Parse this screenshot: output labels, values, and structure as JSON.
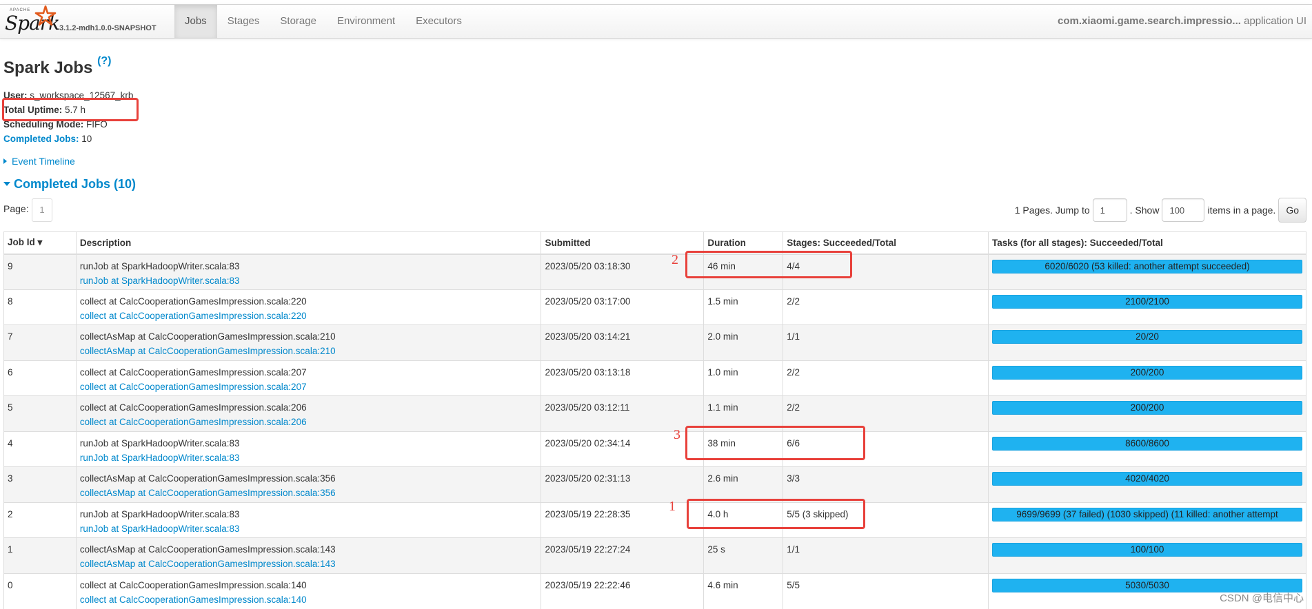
{
  "brand": {
    "apache": "APACHE",
    "name": "Spark",
    "version": "3.1.2-mdh1.0.0-SNAPSHOT"
  },
  "nav": {
    "tabs": [
      "Jobs",
      "Stages",
      "Storage",
      "Environment",
      "Executors"
    ],
    "active": "Jobs",
    "app_name": "com.xiaomi.game.search.impressio...",
    "app_suffix": " application UI"
  },
  "page": {
    "title": "Spark Jobs",
    "help": "(?)"
  },
  "summary": {
    "user_label": "User:",
    "user_value": "s_workspace_12567_krb",
    "uptime_label": "Total Uptime:",
    "uptime_value": "5.7 h",
    "scheduling_label": "Scheduling Mode:",
    "scheduling_value": "FIFO",
    "completed_label": "Completed Jobs:",
    "completed_value": "10"
  },
  "event_timeline": "Event Timeline",
  "section": {
    "title": "Completed Jobs (10)"
  },
  "pagination": {
    "page_label": "Page:",
    "current_page": "1",
    "pages_text": "1 Pages. Jump to",
    "jump_value": "1",
    "show_text": ". Show",
    "show_value": "100",
    "items_text": "items in a page.",
    "go_label": "Go"
  },
  "table": {
    "headers": [
      "Job Id ▾",
      "Description",
      "Submitted",
      "Duration",
      "Stages: Succeeded/Total",
      "Tasks (for all stages): Succeeded/Total"
    ],
    "rows": [
      {
        "id": "9",
        "desc": "runJob at SparkHadoopWriter.scala:83",
        "link": "runJob at SparkHadoopWriter.scala:83",
        "submitted": "2023/05/20 03:18:30",
        "duration": "46 min",
        "stages": "4/4",
        "tasks": "6020/6020 (53 killed: another attempt succeeded)"
      },
      {
        "id": "8",
        "desc": "collect at CalcCooperationGamesImpression.scala:220",
        "link": "collect at CalcCooperationGamesImpression.scala:220",
        "submitted": "2023/05/20 03:17:00",
        "duration": "1.5 min",
        "stages": "2/2",
        "tasks": "2100/2100"
      },
      {
        "id": "7",
        "desc": "collectAsMap at CalcCooperationGamesImpression.scala:210",
        "link": "collectAsMap at CalcCooperationGamesImpression.scala:210",
        "submitted": "2023/05/20 03:14:21",
        "duration": "2.0 min",
        "stages": "1/1",
        "tasks": "20/20"
      },
      {
        "id": "6",
        "desc": "collect at CalcCooperationGamesImpression.scala:207",
        "link": "collect at CalcCooperationGamesImpression.scala:207",
        "submitted": "2023/05/20 03:13:18",
        "duration": "1.0 min",
        "stages": "2/2",
        "tasks": "200/200"
      },
      {
        "id": "5",
        "desc": "collect at CalcCooperationGamesImpression.scala:206",
        "link": "collect at CalcCooperationGamesImpression.scala:206",
        "submitted": "2023/05/20 03:12:11",
        "duration": "1.1 min",
        "stages": "2/2",
        "tasks": "200/200"
      },
      {
        "id": "4",
        "desc": "runJob at SparkHadoopWriter.scala:83",
        "link": "runJob at SparkHadoopWriter.scala:83",
        "submitted": "2023/05/20 02:34:14",
        "duration": "38 min",
        "stages": "6/6",
        "tasks": "8600/8600"
      },
      {
        "id": "3",
        "desc": "collectAsMap at CalcCooperationGamesImpression.scala:356",
        "link": "collectAsMap at CalcCooperationGamesImpression.scala:356",
        "submitted": "2023/05/20 02:31:13",
        "duration": "2.6 min",
        "stages": "3/3",
        "tasks": "4020/4020"
      },
      {
        "id": "2",
        "desc": "runJob at SparkHadoopWriter.scala:83",
        "link": "runJob at SparkHadoopWriter.scala:83",
        "submitted": "2023/05/19 22:28:35",
        "duration": "4.0 h",
        "stages": "5/5 (3 skipped)",
        "tasks": "9699/9699 (37 failed) (1030 skipped) (11 killed: another attempt"
      },
      {
        "id": "1",
        "desc": "collectAsMap at CalcCooperationGamesImpression.scala:143",
        "link": "collectAsMap at CalcCooperationGamesImpression.scala:143",
        "submitted": "2023/05/19 22:27:24",
        "duration": "25 s",
        "stages": "1/1",
        "tasks": "100/100"
      },
      {
        "id": "0",
        "desc": "collect at CalcCooperationGamesImpression.scala:140",
        "link": "collect at CalcCooperationGamesImpression.scala:140",
        "submitted": "2023/05/19 22:22:46",
        "duration": "4.6 min",
        "stages": "5/5",
        "tasks": "5030/5030"
      }
    ]
  },
  "annotations": {
    "n1": "1",
    "n2": "2",
    "n3": "3"
  },
  "watermark": "CSDN @电信中心",
  "colors": {
    "link": "#0088cc",
    "progress": "#1fb2f0",
    "annotation": "#e8413b"
  }
}
